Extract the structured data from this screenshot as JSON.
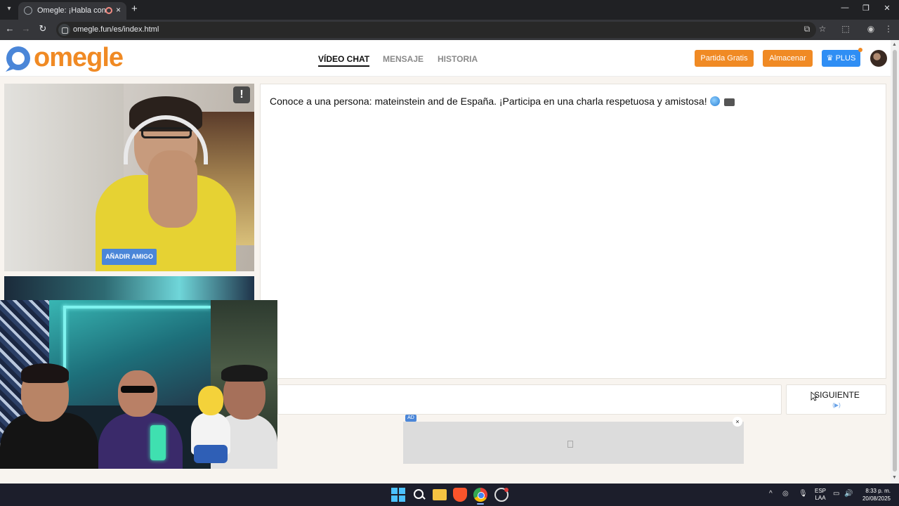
{
  "browser": {
    "tab_title": "Omegle: ¡Habla con Desconocidos!",
    "url": "omegle.fun/es/index.html",
    "new_tab": "+",
    "tab_close": "×"
  },
  "header": {
    "logo_text": "omegle",
    "nav": [
      "VÍDEO CHAT",
      "MENSAJE",
      "HISTORIA"
    ],
    "buttons": {
      "free_game": "Partida Gratis",
      "store": "Almacenar",
      "plus": "PLUS"
    }
  },
  "video": {
    "report_icon": "!",
    "add_friend": "AÑADIR AMIGO"
  },
  "chat": {
    "message": "Conoce a una persona: mateinstein and de España. ¡Participa en una charla respetuosa y amistosa!",
    "message_placeholder": ""
  },
  "next_button": {
    "label": "SIGUIENTE"
  },
  "ad": {
    "tag": "AD",
    "close": "×"
  },
  "taskbar": {
    "lang_line1": "ESP",
    "lang_line2": "LAA",
    "time": "8:33 p. m.",
    "date": "20/08/2025"
  },
  "colors": {
    "brand_orange": "#f08a24",
    "brand_blue": "#2f8ef4",
    "page_bg": "#f8f4ef"
  }
}
